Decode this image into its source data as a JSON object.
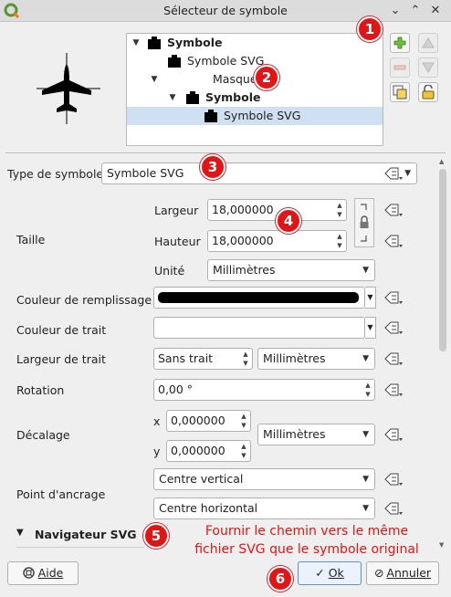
{
  "window": {
    "title": "Sélecteur de symbole",
    "controls": [
      "⌄",
      "⌃",
      "✕"
    ]
  },
  "tree": {
    "items": [
      {
        "label": "Symbole",
        "bold": true
      },
      {
        "label": "Symbole SVG",
        "bold": false
      },
      {
        "label": "Masque",
        "bold": false
      },
      {
        "label": "Symbole",
        "bold": true
      },
      {
        "label": "Symbole SVG",
        "bold": false,
        "selected": true
      }
    ]
  },
  "form": {
    "symbol_type_label": "Type de symbole",
    "symbol_type_value": "Symbole SVG",
    "size_label": "Taille",
    "width_label": "Largeur",
    "width_value": "18,000000",
    "height_label": "Hauteur",
    "height_value": "18,000000",
    "unit_label": "Unité",
    "unit_value": "Millimètres",
    "fill_color_label": "Couleur de remplissage",
    "fill_color": "#000000",
    "stroke_color_label": "Couleur de trait",
    "stroke_color": "#ffffff",
    "stroke_width_label": "Largeur de trait",
    "stroke_width_value": "Sans trait",
    "stroke_unit_value": "Millimètres",
    "rotation_label": "Rotation",
    "rotation_value": "0,00 °",
    "offset_label": "Décalage",
    "offset_x_label": "x",
    "offset_x_value": "0,000000",
    "offset_y_label": "y",
    "offset_y_value": "0,000000",
    "offset_unit_value": "Millimètres",
    "anchor_label": "Point d'ancrage",
    "anchor_vertical_value": "Centre vertical",
    "anchor_horizontal_value": "Centre horizontal",
    "svg_browser_label": "Navigateur SVG"
  },
  "buttons": {
    "help": "Aide",
    "ok": "Ok",
    "cancel": "Annuler"
  },
  "annotations": {
    "badges": [
      "1",
      "2",
      "3",
      "4",
      "5",
      "6"
    ],
    "note_line1": "Fournir le chemin vers le même",
    "note_line2": "fichier SVG que le symbole original",
    "color": "#e01515"
  }
}
